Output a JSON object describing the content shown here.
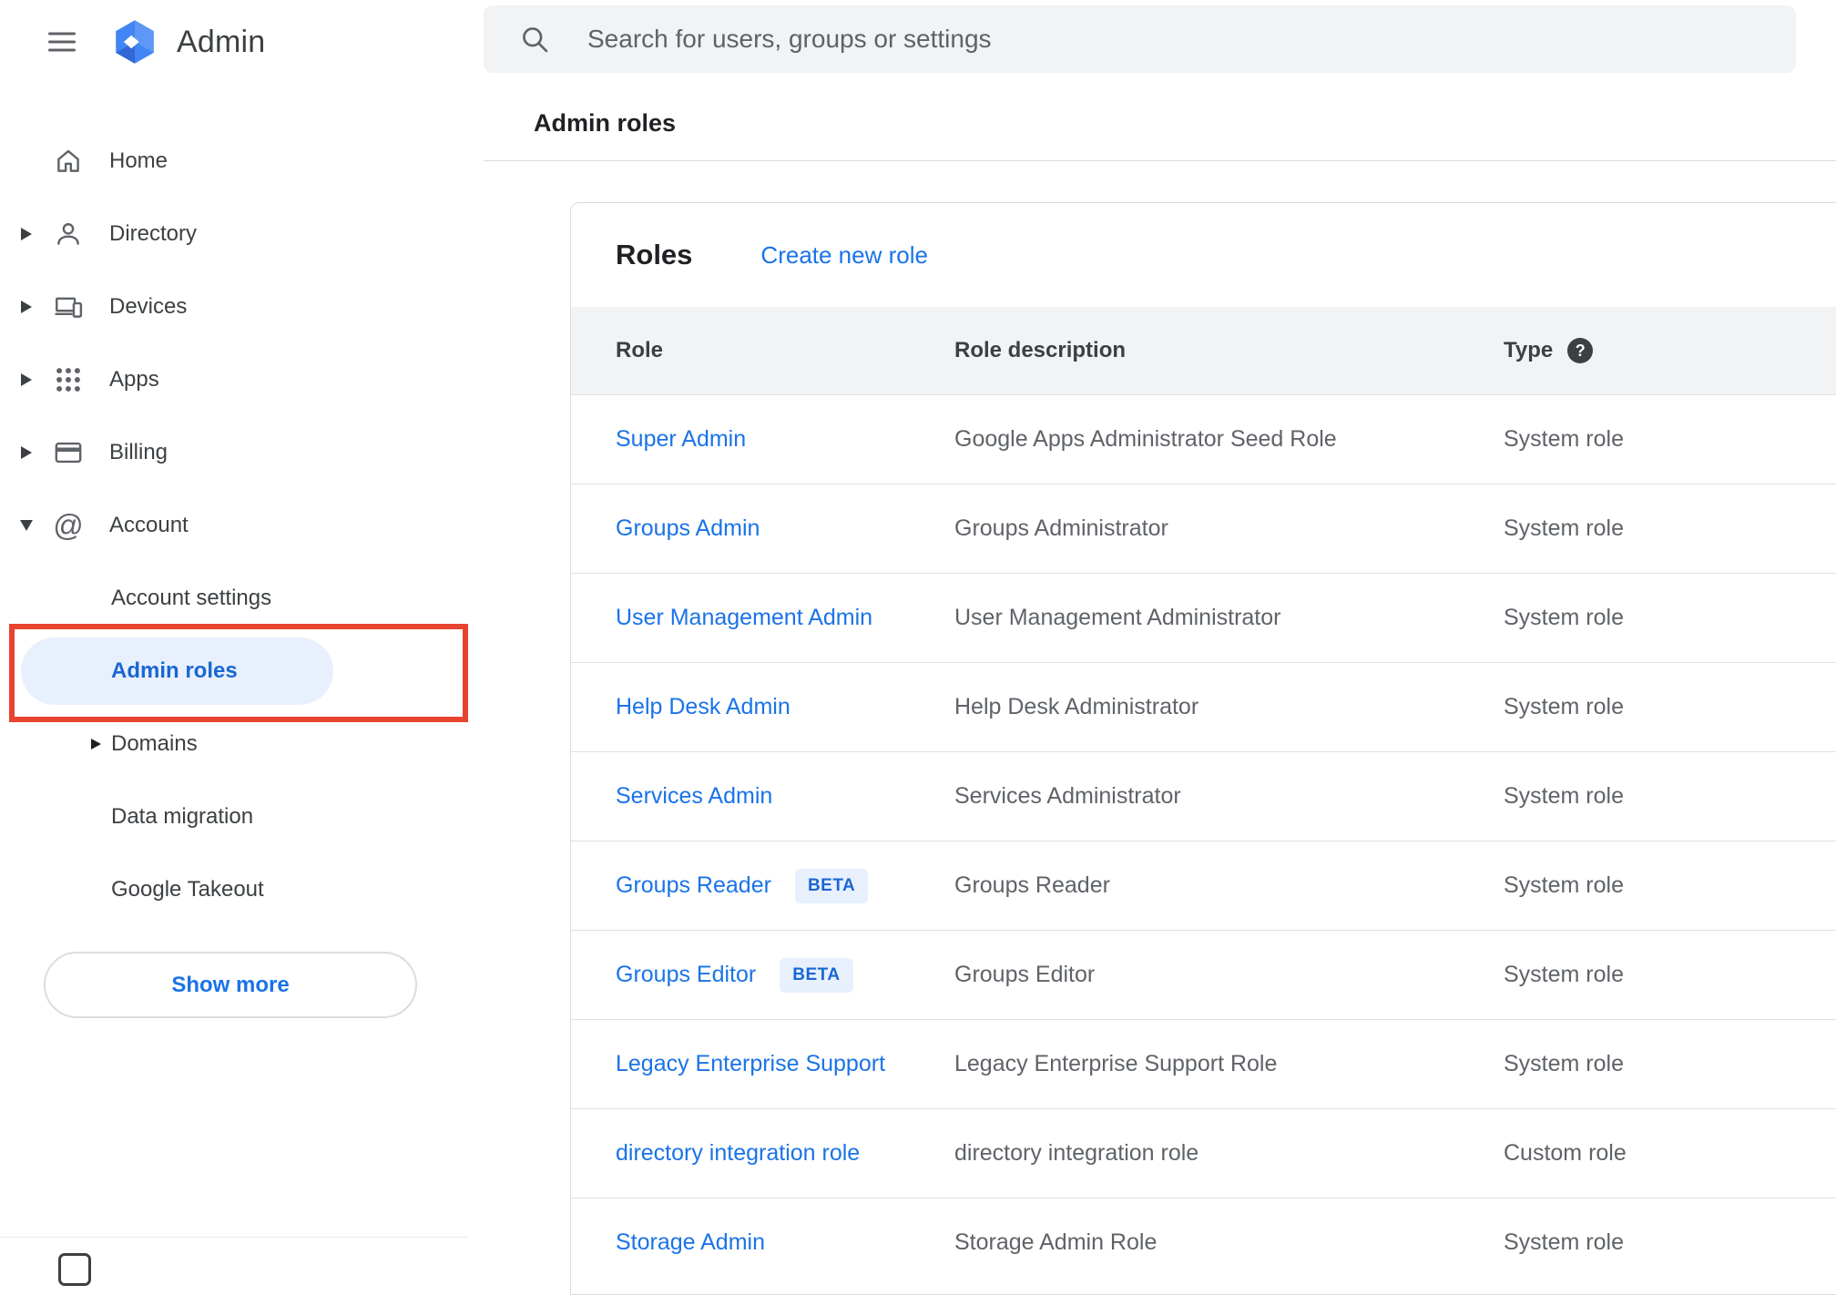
{
  "app": {
    "title": "Admin"
  },
  "search": {
    "placeholder": "Search for users, groups or settings"
  },
  "breadcrumb": "Admin roles",
  "sidebar": {
    "items": [
      {
        "label": "Home",
        "icon": "home-icon",
        "expander": "none"
      },
      {
        "label": "Directory",
        "icon": "person-icon",
        "expander": "collapsed"
      },
      {
        "label": "Devices",
        "icon": "devices-icon",
        "expander": "collapsed"
      },
      {
        "label": "Apps",
        "icon": "apps-grid-icon",
        "expander": "collapsed"
      },
      {
        "label": "Billing",
        "icon": "credit-card-icon",
        "expander": "collapsed"
      },
      {
        "label": "Account",
        "icon": "at-sign-icon",
        "expander": "expanded"
      }
    ],
    "account_children": [
      {
        "label": "Account settings",
        "selected": false
      },
      {
        "label": "Admin roles",
        "selected": true
      },
      {
        "label": "Domains",
        "expander": "collapsed"
      },
      {
        "label": "Data migration"
      },
      {
        "label": "Google Takeout"
      }
    ],
    "show_more_label": "Show more"
  },
  "roles_card": {
    "title": "Roles",
    "create_link": "Create new role",
    "beta_label": "BETA",
    "columns": {
      "role": "Role",
      "description": "Role description",
      "type": "Type"
    },
    "rows": [
      {
        "role": "Super Admin",
        "description": "Google Apps Administrator Seed Role",
        "type": "System role"
      },
      {
        "role": "Groups Admin",
        "description": "Groups Administrator",
        "type": "System role"
      },
      {
        "role": "User Management Admin",
        "description": "User Management Administrator",
        "type": "System role"
      },
      {
        "role": "Help Desk Admin",
        "description": "Help Desk Administrator",
        "type": "System role"
      },
      {
        "role": "Services Admin",
        "description": "Services Administrator",
        "type": "System role"
      },
      {
        "role": "Groups Reader",
        "beta": true,
        "description": "Groups Reader",
        "type": "System role"
      },
      {
        "role": "Groups Editor",
        "beta": true,
        "description": "Groups Editor",
        "type": "System role"
      },
      {
        "role": "Legacy Enterprise Support",
        "description": "Legacy Enterprise Support Role",
        "type": "System role"
      },
      {
        "role": "directory integration role",
        "description": "directory integration role",
        "type": "Custom role"
      },
      {
        "role": "Storage Admin",
        "description": "Storage Admin Role",
        "type": "System role"
      }
    ]
  },
  "colors": {
    "link_blue": "#1a73e8",
    "selected_blue_text": "#1967d2",
    "selected_pill_bg": "#e8f0fe",
    "annotation_red": "#e8432f",
    "search_bg": "#f1f3f4",
    "table_header_bg": "#f1f3f4",
    "divider": "#dadce0"
  }
}
